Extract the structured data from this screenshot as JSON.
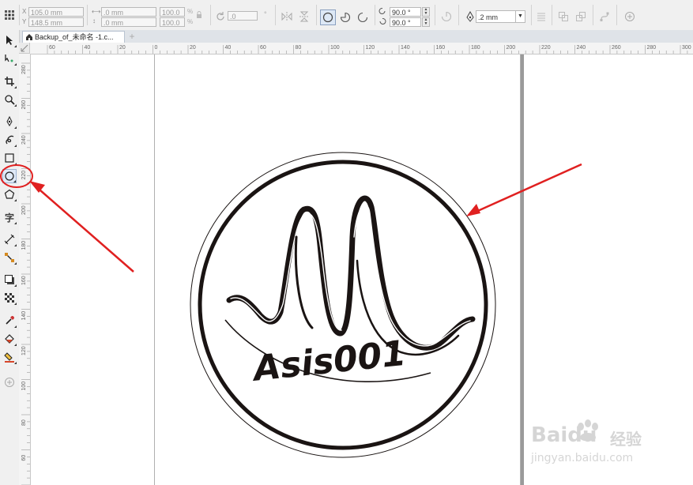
{
  "property_bar": {
    "x_value": "105.0 mm",
    "y_value": "148.5 mm",
    "width_value": ".0 mm",
    "height_value": ".0 mm",
    "scale_x": "100.0",
    "scale_y": "100.0",
    "rotation": ".0",
    "start_angle": "90.0 °",
    "end_angle": "90.0 °",
    "outline_width": ".2 mm"
  },
  "document_tab": {
    "title": "Backup_of_未命名 -1.c..."
  },
  "ruler_top": {
    "labels": [
      "60",
      "40",
      "20",
      "0",
      "20",
      "40",
      "60",
      "80",
      "100",
      "120",
      "140",
      "160",
      "180",
      "200",
      "220",
      "240",
      "260",
      "280",
      "300"
    ]
  },
  "ruler_left": {
    "labels": [
      "280",
      "260",
      "240",
      "220",
      "200",
      "180",
      "160",
      "140",
      "120",
      "100",
      "80",
      "60",
      "40"
    ]
  },
  "logo": {
    "text": "Asis001"
  },
  "watermark": {
    "brand": "Baidu",
    "brand_cn": "经验",
    "url": "jingyan.baidu.com"
  },
  "colors": {
    "annotation": "#e02020",
    "ink": "#1a1413"
  }
}
